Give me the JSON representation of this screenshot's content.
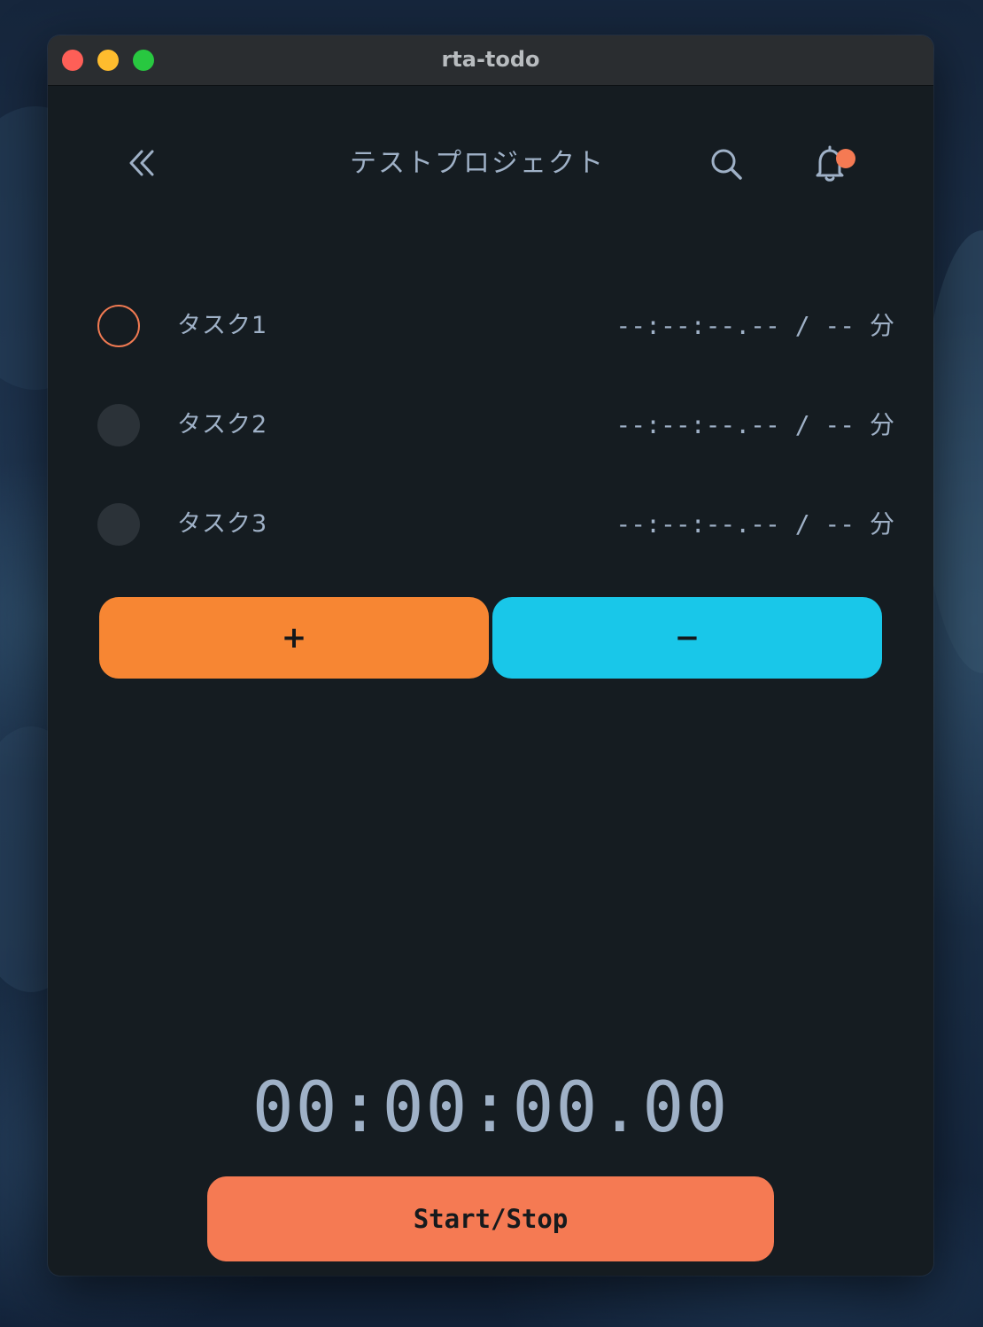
{
  "window": {
    "title": "rta-todo"
  },
  "header": {
    "title": "テストプロジェクト",
    "back_icon": "double-chevron-left-icon",
    "search_icon": "search-icon",
    "bell_icon": "bell-icon",
    "notification_badge": true
  },
  "tasks": [
    {
      "name": "タスク1",
      "time": "--:--:--.-- / -- 分",
      "state": "active"
    },
    {
      "name": "タスク2",
      "time": "--:--:--.-- / -- 分",
      "state": "idle"
    },
    {
      "name": "タスク3",
      "time": "--:--:--.-- / -- 分",
      "state": "idle"
    }
  ],
  "controls": {
    "add_label": "+",
    "remove_label": "−"
  },
  "timer": {
    "display": "00:00:00.00",
    "start_stop_label": "Start/Stop"
  },
  "colors": {
    "window_bg": "#151c21",
    "text": "#9fb1c7",
    "accent_orange": "#f78633",
    "accent_cyan": "#19c7e9",
    "accent_coral": "#f57a53"
  }
}
